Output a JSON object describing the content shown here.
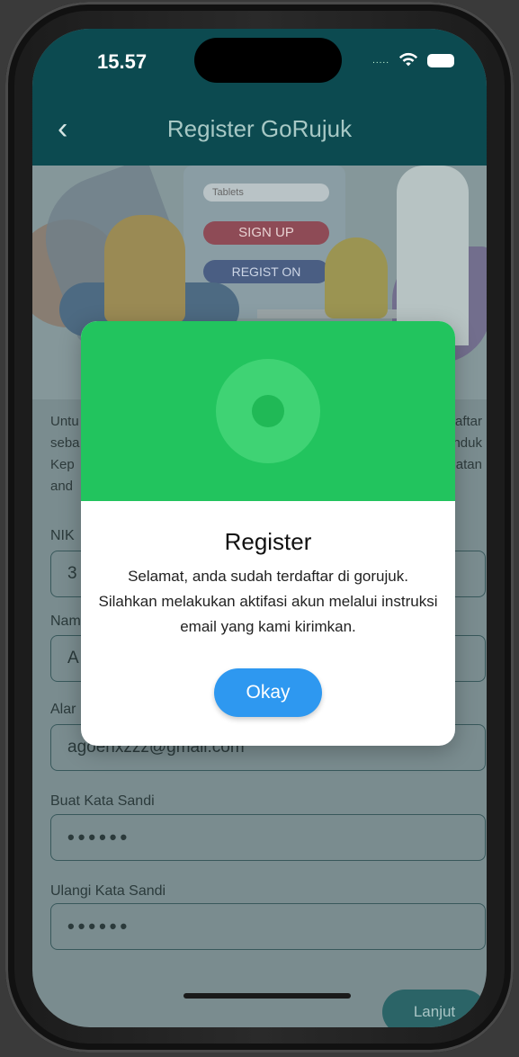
{
  "status_bar": {
    "time": "15.57",
    "signal": "....."
  },
  "header": {
    "title": "Register GoRujuk"
  },
  "illustration": {
    "field_text": "Tablets",
    "signup_label": "SIGN UP",
    "register_label": "REGIST   ON"
  },
  "form": {
    "intro_lines": [
      "Untu",
      "seba",
      "Kep",
      "and"
    ],
    "intro_right": [
      "aftar",
      "nduk",
      "atan"
    ],
    "nik_label": "NIK",
    "nik_value": "3",
    "nama_label": "Nam",
    "nama_value": "A",
    "alamat_label": "Alar",
    "email_value": "agoenxzzz@gmail.com",
    "buat_label": "Buat Kata Sandi",
    "buat_value": "••••••",
    "ulangi_label": "Ulangi Kata Sandi",
    "ulangi_value": "••••••",
    "next_label": "Lanjut"
  },
  "modal": {
    "title": "Register",
    "message": "Selamat, anda sudah terdaftar di gorujuk. Silahkan melakukan aktifasi akun melalui instruksi email yang kami kirimkan.",
    "okay_label": "Okay"
  },
  "colors": {
    "header": "#0c4a50",
    "success": "#22c45e",
    "primary": "#2e98f0"
  }
}
